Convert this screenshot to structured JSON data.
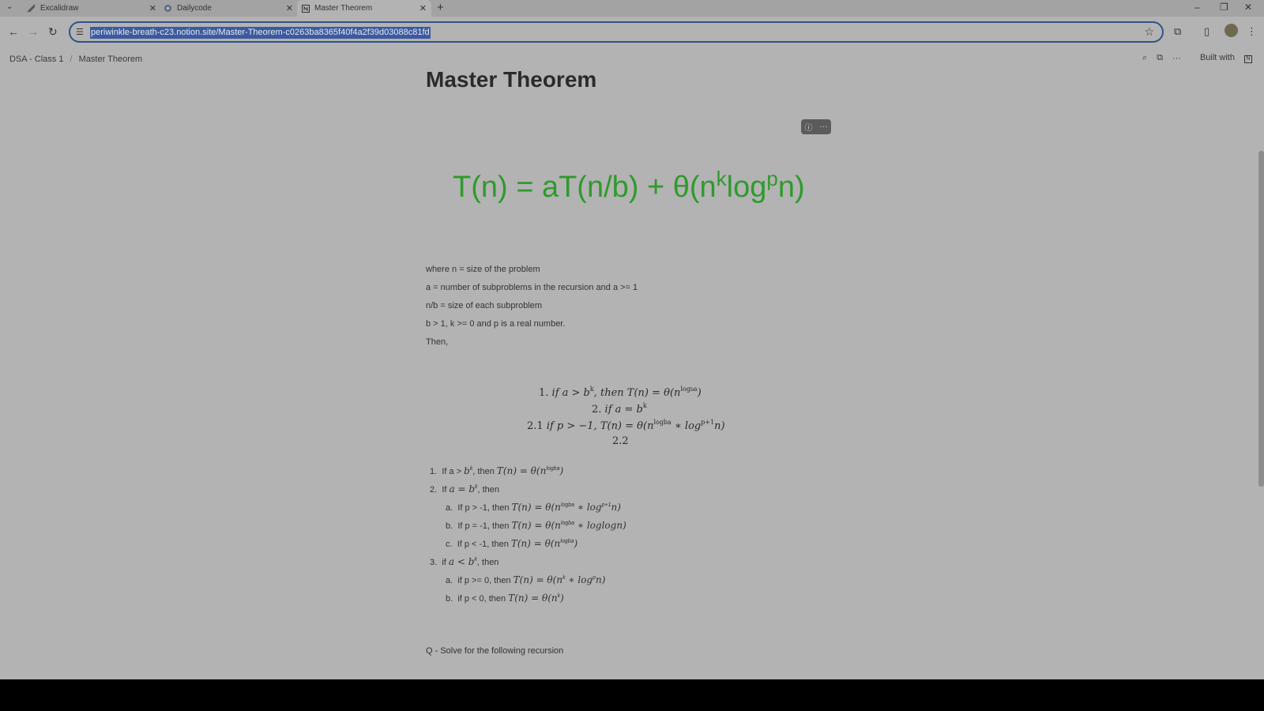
{
  "tabs": [
    {
      "title": "Excalidraw",
      "close": "✕"
    },
    {
      "title": "Dailycode",
      "close": "✕"
    },
    {
      "title": "Master Theorem",
      "close": "✕"
    }
  ],
  "new_tab": "+",
  "address_bar": {
    "url": "periwinkle-breath-c23.notion.site/Master-Theorem-c0263ba8365f40f4a2f39d03088c81fd"
  },
  "breadcrumb": {
    "parent": "DSA - Class 1",
    "separator": "/",
    "current": "Master Theorem"
  },
  "topbar": {
    "built_with": "Built with",
    "built_with_logo": "N"
  },
  "page": {
    "title": "Master Theorem",
    "formula_image": {
      "main": "T(n) = aT(n/b) + θ(n",
      "k": "k",
      "log": "log",
      "p": "p",
      "tail": "n)"
    },
    "paragraphs": [
      "where n = size of the problem",
      "a = number of subproblems in the recursion and a >= 1",
      "n/b = size of each subproblem",
      "b > 1, k >= 0 and p is a real number.",
      "Then,"
    ],
    "math_block": {
      "line1": {
        "pre": "1. ",
        "a": "if a > b",
        "sup1": "k",
        "b": ", then T(n) = θ(n",
        "sup2": "log",
        "sub2": "b",
        "sup2b": "a",
        "c": ")"
      },
      "line2": {
        "pre": "2. ",
        "a": "if a = b",
        "sup1": "k"
      },
      "line3": {
        "pre": "2.1 ",
        "a": "if p > −1, T(n) = θ(n",
        "sup1": "logba",
        "b": " ∗ log",
        "sup2": "p+1",
        "c": "n)"
      },
      "line4": "2.2"
    },
    "list": {
      "i1": {
        "num": "1.",
        "t1": "If a > ",
        "m1": "b",
        "s1": "k",
        "t2": ", then ",
        "m2": "T(n) = θ(n",
        "s2": "logba",
        "m3": ")"
      },
      "i2": {
        "num": "2.",
        "t1": "If ",
        "m1": "a = b",
        "s1": "k",
        "t2": ", then"
      },
      "i2a": {
        "num": "a.",
        "t1": "If p > -1, then ",
        "m1": "T(n) = θ(n",
        "s1": "logba",
        "m2": " ∗ log",
        "s2": "p+1",
        "m3": "n)"
      },
      "i2b": {
        "num": "b.",
        "t1": "If p = -1, then ",
        "m1": "T(n) = θ(n",
        "s1": "logba",
        "m2": " ∗ loglogn)"
      },
      "i2c": {
        "num": "c.",
        "t1": "If p < -1, then ",
        "m1": "T(n) = θ(n",
        "s1": "logba",
        "m2": ")"
      },
      "i3": {
        "num": "3.",
        "t1": "if ",
        "m1": "a < b",
        "s1": "k",
        "t2": ", then"
      },
      "i3a": {
        "num": "a.",
        "t1": "if p >= 0, then ",
        "m1": "T(n) = θ(n",
        "s1": "k",
        "m2": " ∗ log",
        "s2": "p",
        "m3": "n)"
      },
      "i3b": {
        "num": "b.",
        "t1": "if p < 0, then ",
        "m1": "T(n) = θ(n",
        "s1": "k",
        "m2": ")"
      }
    },
    "question": "Q - Solve for the following recursion"
  }
}
